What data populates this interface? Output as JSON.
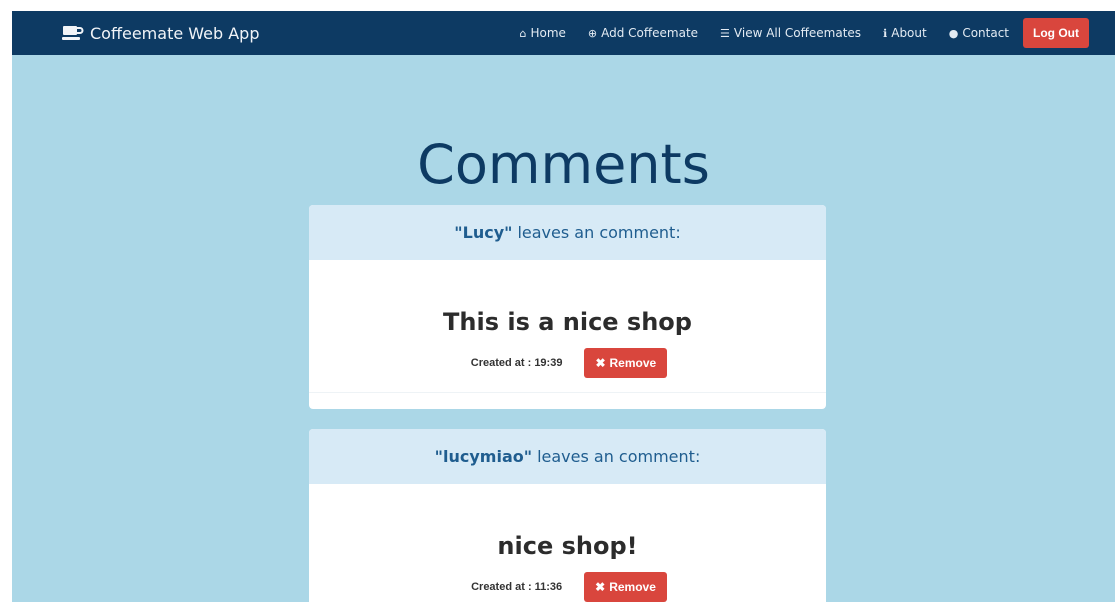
{
  "navbar": {
    "brand": "Coffeemate Web App",
    "items": [
      {
        "label": "Home",
        "icon": "home-icon",
        "glyph": "⌂"
      },
      {
        "label": "Add Coffeemate",
        "icon": "plus-circle-icon",
        "glyph": "⊕"
      },
      {
        "label": "View All Coffeemates",
        "icon": "list-icon",
        "glyph": "☰"
      },
      {
        "label": "About",
        "icon": "info-icon",
        "glyph": "ℹ"
      },
      {
        "label": "Contact",
        "icon": "comment-icon",
        "glyph": "●"
      }
    ],
    "logout": "Log Out"
  },
  "page": {
    "title": "Comments"
  },
  "comments": [
    {
      "author": "\"Lucy\"",
      "header_suffix": "leaves an comment:",
      "text": "This is a nice shop",
      "created_label": "Created at :",
      "created_time": "19:39",
      "remove_label": "Remove",
      "remove_glyph": "✖"
    },
    {
      "author": "\"lucymiao\"",
      "header_suffix": "leaves an comment:",
      "text": "nice shop!",
      "created_label": "Created at :",
      "created_time": "11:36",
      "remove_label": "Remove",
      "remove_glyph": "✖"
    }
  ],
  "colors": {
    "navbar_bg": "#0d3a63",
    "page_bg": "#abd7e7",
    "danger": "#d9463d",
    "card_header_bg": "#d7eaf6",
    "title": "#0d3a63"
  }
}
